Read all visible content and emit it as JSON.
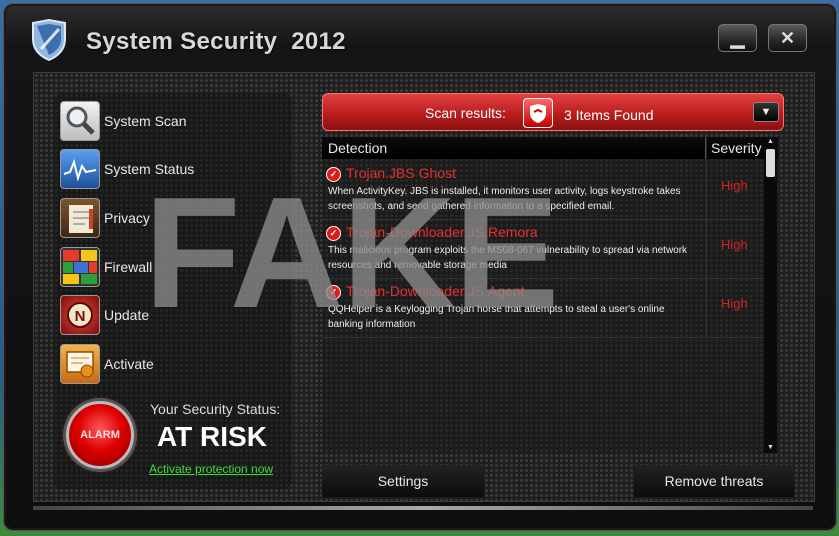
{
  "window": {
    "title": "System Security  2012",
    "minimize_label": "▁",
    "close_label": "✕"
  },
  "sidebar": {
    "items": [
      {
        "label": "System Scan",
        "icon": "magnifier-icon",
        "color": "#cfcfcf"
      },
      {
        "label": "System Status",
        "icon": "pulse-chart-icon",
        "color": "#3d7fd8"
      },
      {
        "label": "Privacy",
        "icon": "notebook-icon",
        "color": "#6b4a2a"
      },
      {
        "label": "Firewall",
        "icon": "brick-wall-icon",
        "color": "#e0a020"
      },
      {
        "label": "Update",
        "icon": "update-badge-icon",
        "color": "#b01818"
      },
      {
        "label": "Activate",
        "icon": "certificate-icon",
        "color": "#e8901e"
      }
    ],
    "status": {
      "title": "Your Security Status:",
      "value": "AT RISK",
      "link": "Activate protection now",
      "alarm_label": "ALARM"
    }
  },
  "scan": {
    "label": "Scan results:",
    "count": "3 Items Found",
    "dropdown_icon": "▼"
  },
  "table": {
    "headers": {
      "detection": "Detection",
      "severity": "Severity"
    },
    "rows": [
      {
        "name": "Trojan.JBS Ghost",
        "desc": "When ActivityKey. JBS is installed, it monitors user activity, logs keystroke takes screenshots, and send gathered information to a specified email.",
        "severity": "High"
      },
      {
        "name": "Trojan-Downloader.JS.Remora",
        "desc": "This malicious program exploits the MS08-067 vulnerability to spread via network resources and removable storage media",
        "severity": "High"
      },
      {
        "name": "Trojan-Downloader.JS.Agent",
        "desc": "QQHelper is a Keylogging Trojan horse that attempts to steal a user's online banking information",
        "severity": "High"
      }
    ]
  },
  "buttons": {
    "settings": "Settings",
    "remove": "Remove threats"
  },
  "overlay": {
    "text": "FAKE"
  },
  "colors": {
    "accent_red": "#d02525",
    "link_green": "#3cdc3c"
  }
}
